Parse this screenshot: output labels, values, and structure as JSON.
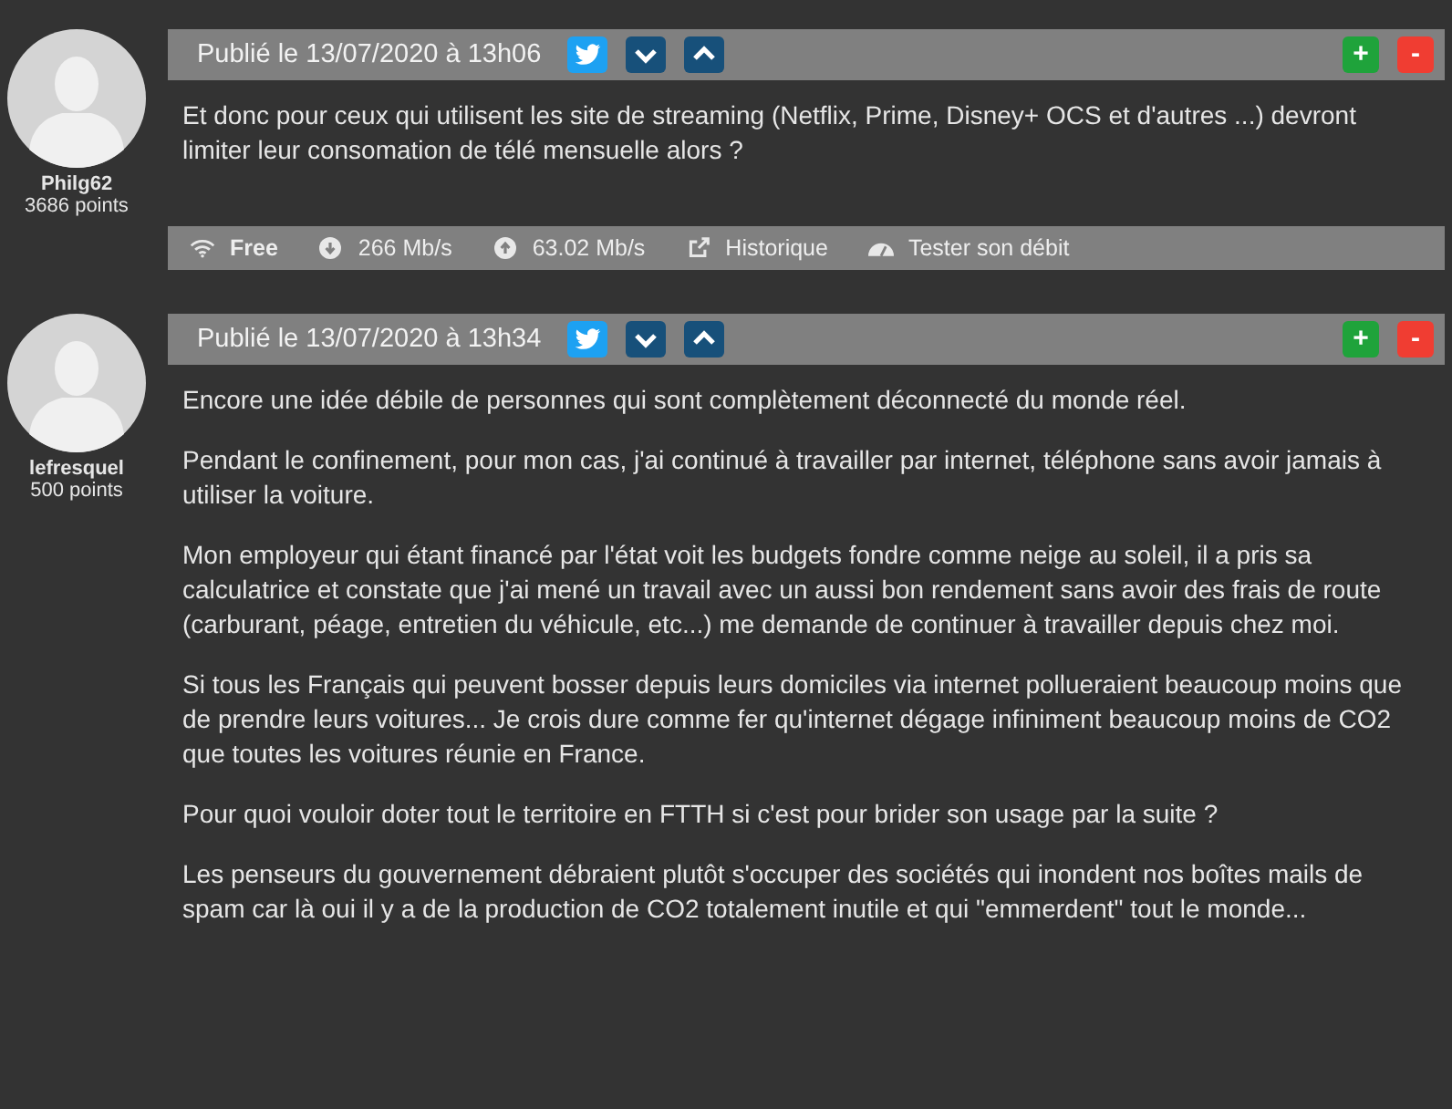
{
  "posts": [
    {
      "author": "Philg62",
      "points": "3686 points",
      "published": "Publié le 13/07/2020 à 13h06",
      "vote_up": "+",
      "vote_down": "-",
      "paragraphs": [
        "Et donc pour ceux qui utilisent les site de streaming (Netflix, Prime, Disney+ OCS et d'autres ...) devront limiter leur consomation de télé mensuelle alors ?"
      ],
      "connection": {
        "provider": "Free",
        "download": "266 Mb/s",
        "upload": "63.02 Mb/s",
        "history": "Historique",
        "speedtest": "Tester son débit"
      }
    },
    {
      "author": "lefresquel",
      "points": "500 points",
      "published": "Publié le 13/07/2020 à 13h34",
      "vote_up": "+",
      "vote_down": "-",
      "paragraphs": [
        "Encore une idée débile de personnes qui sont complètement déconnecté du monde réel.",
        "Pendant le confinement, pour mon cas, j'ai continué à travailler par internet, téléphone sans avoir jamais à utiliser la voiture.",
        "Mon employeur qui étant financé par l'état voit les budgets fondre comme neige au soleil, il a pris sa calculatrice et constate que j'ai mené un travail avec un aussi bon rendement sans avoir des frais de route (carburant, péage, entretien du véhicule, etc...) me demande de continuer à travailler depuis chez moi.",
        "Si tous les Français qui peuvent bosser depuis leurs domiciles via internet pollueraient beaucoup moins que de prendre leurs voitures... Je crois dure comme fer qu'internet dégage infiniment beaucoup moins de CO2 que toutes les voitures réunie en France.",
        "Pour quoi vouloir doter tout le territoire en FTTH si c'est pour brider son usage par la suite ?",
        "Les penseurs du gouvernement débraient plutôt s'occuper des sociétés qui inondent nos boîtes mails de spam car là oui il y a de la production de CO2 totalement inutile et qui \"emmerdent\" tout le monde..."
      ]
    }
  ]
}
